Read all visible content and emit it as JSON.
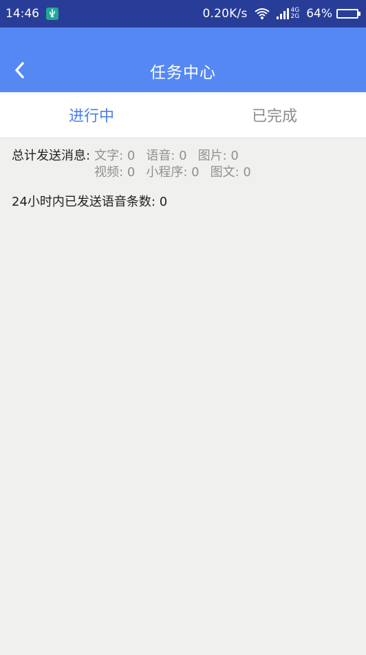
{
  "status_bar": {
    "time": "14:46",
    "net_speed": "0.20K/s",
    "net_type_top": "4G",
    "net_type_bottom": "2G",
    "battery": "64%",
    "battery_level": 0.64
  },
  "header": {
    "title": "任务中心",
    "background": "#5688f4"
  },
  "tabs": [
    {
      "label": "进行中",
      "active": true
    },
    {
      "label": "已完成",
      "active": false
    }
  ],
  "stats": {
    "total_label": "总计发送消息:",
    "items": [
      {
        "label": "文字:",
        "value": "0"
      },
      {
        "label": "语音:",
        "value": "0"
      },
      {
        "label": "图片:",
        "value": "0"
      },
      {
        "label": "视频:",
        "value": "0"
      },
      {
        "label": "小程序:",
        "value": "0"
      },
      {
        "label": "图文:",
        "value": "0"
      }
    ],
    "voice_24h_label": "24小时内已发送语音条数:",
    "voice_24h_value": "0"
  },
  "colors": {
    "status_bar": "#283d98",
    "accent": "#4a7ee8",
    "content_bg": "#f0f0ef"
  }
}
